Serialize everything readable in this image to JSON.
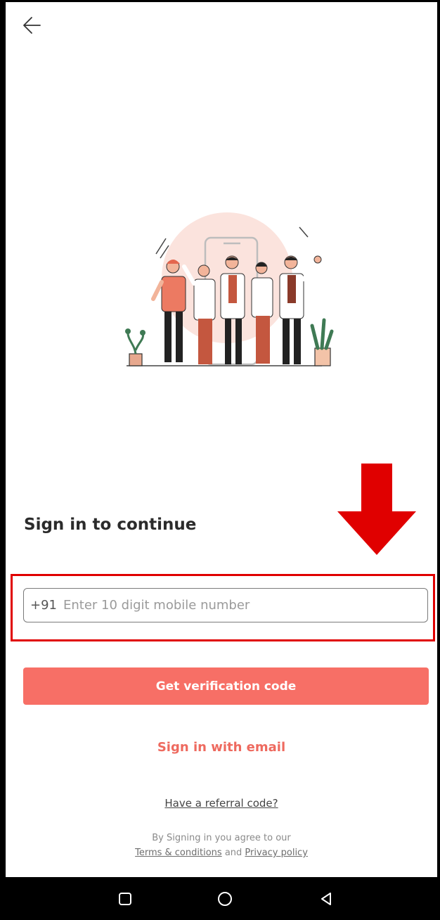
{
  "header": {
    "back_icon": "arrow-left-icon"
  },
  "title": "Sign in to continue",
  "phone": {
    "country_code": "+91",
    "placeholder": "Enter 10 digit mobile number",
    "value": ""
  },
  "buttons": {
    "verification": "Get verification code",
    "email": "Sign in with email",
    "referral": "Have a referral code?"
  },
  "legal": {
    "agree": "By Signing in you agree to our",
    "terms": "Terms & conditions",
    "and": "and",
    "privacy": "Privacy policy"
  },
  "colors": {
    "accent": "#f76f66",
    "annotation": "#e00000"
  },
  "navbar": {
    "items": [
      "square-icon",
      "circle-icon",
      "triangle-back-icon"
    ]
  }
}
